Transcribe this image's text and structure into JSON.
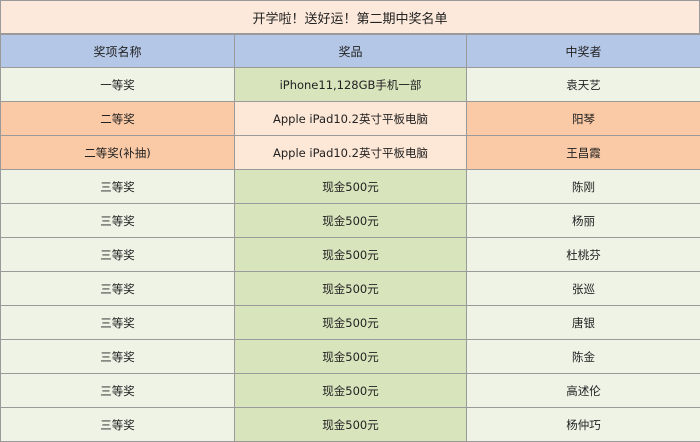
{
  "title": "开学啦！送好运！第二期中奖名单",
  "headers": [
    "奖项名称",
    "奖品",
    "中奖者"
  ],
  "colors": {
    "title_bg": "#fce9db",
    "header_bg": "#b4c7e7",
    "green_light": "#eef3e6",
    "green_mid": "#d8e4bc",
    "orange_strong": "#fac9a5",
    "orange_light": "#fde7d6",
    "grid": "#9a9a9a"
  },
  "rows": [
    {
      "level": "一等奖",
      "prize": "iPhone11,128GB手机一部",
      "winner": "袁天艺",
      "style": "green"
    },
    {
      "level": "二等奖",
      "prize": "Apple iPad10.2英寸平板电脑",
      "winner": "阳琴",
      "style": "orange"
    },
    {
      "level": "二等奖(补抽)",
      "prize": "Apple iPad10.2英寸平板电脑",
      "winner": "王昌霞",
      "style": "orange"
    },
    {
      "level": "三等奖",
      "prize": "现金500元",
      "winner": "陈刚",
      "style": "green"
    },
    {
      "level": "三等奖",
      "prize": "现金500元",
      "winner": "杨丽",
      "style": "green"
    },
    {
      "level": "三等奖",
      "prize": "现金500元",
      "winner": "杜桃芬",
      "style": "green"
    },
    {
      "level": "三等奖",
      "prize": "现金500元",
      "winner": "张巡",
      "style": "green"
    },
    {
      "level": "三等奖",
      "prize": "现金500元",
      "winner": "唐银",
      "style": "green"
    },
    {
      "level": "三等奖",
      "prize": "现金500元",
      "winner": "陈金",
      "style": "green"
    },
    {
      "level": "三等奖",
      "prize": "现金500元",
      "winner": "高述伦",
      "style": "green"
    },
    {
      "level": "三等奖",
      "prize": "现金500元",
      "winner": "杨仲巧",
      "style": "green"
    }
  ]
}
